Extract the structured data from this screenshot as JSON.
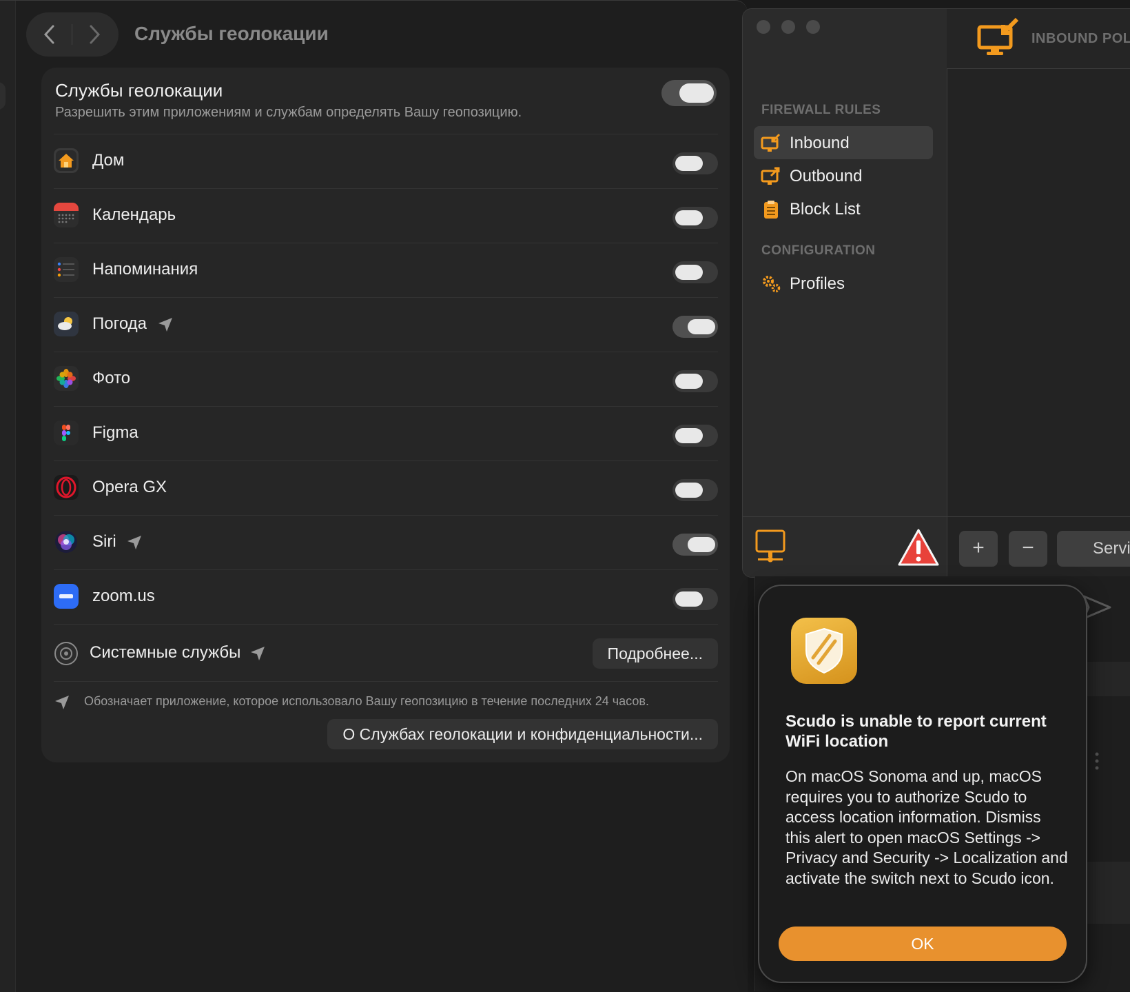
{
  "settings": {
    "title": "Службы геолокации",
    "master": {
      "title": "Службы геолокации",
      "subtitle": "Разрешить этим приложениям и службам определять Вашу геопозицию.",
      "enabled": true
    },
    "apps": [
      {
        "name": "Дом",
        "icon": "home-icon",
        "recent": false,
        "enabled": false
      },
      {
        "name": "Календарь",
        "icon": "calendar-icon",
        "recent": false,
        "enabled": false
      },
      {
        "name": "Напоминания",
        "icon": "reminders-icon",
        "recent": false,
        "enabled": false
      },
      {
        "name": "Погода",
        "icon": "weather-icon",
        "recent": true,
        "enabled": true
      },
      {
        "name": "Фото",
        "icon": "photos-icon",
        "recent": false,
        "enabled": false
      },
      {
        "name": "Figma",
        "icon": "figma-icon",
        "recent": false,
        "enabled": false
      },
      {
        "name": "Opera GX",
        "icon": "opera-gx-icon",
        "recent": false,
        "enabled": false
      },
      {
        "name": "Siri",
        "icon": "siri-icon",
        "recent": true,
        "enabled": true
      },
      {
        "name": "zoom.us",
        "icon": "zoom-icon",
        "recent": false,
        "enabled": false
      }
    ],
    "system_services": {
      "name": "Системные службы",
      "button": "Подробнее..."
    },
    "legend": "Обозначает приложение, которое использовало Вашу геопозицию в течение последних 24 часов.",
    "about_button": "О Службах геолокации и конфиденциальности..."
  },
  "firewall": {
    "header_title": "INBOUND POL",
    "sections": [
      {
        "title": "FIREWALL RULES",
        "items": [
          {
            "label": "Inbound",
            "icon": "inbound-icon",
            "selected": true
          },
          {
            "label": "Outbound",
            "icon": "outbound-icon",
            "selected": false
          },
          {
            "label": "Block List",
            "icon": "block-list-icon",
            "selected": false
          }
        ]
      },
      {
        "title": "CONFIGURATION",
        "items": [
          {
            "label": "Profiles",
            "icon": "gears-icon",
            "selected": false
          }
        ]
      }
    ],
    "add_label": "+",
    "remove_label": "−",
    "services_label": "Servi"
  },
  "alert": {
    "title": "Scudo is unable to report current WiFi location",
    "body": "On macOS Sonoma and up, macOS requires you to authorize Scudo to access location information. Dismiss this alert to open macOS Settings -> Privacy and Security -> Localization and activate the switch next to Scudo icon.",
    "ok_label": "OK"
  },
  "colors": {
    "accent": "#e8912e",
    "warning": "#e8423a"
  }
}
